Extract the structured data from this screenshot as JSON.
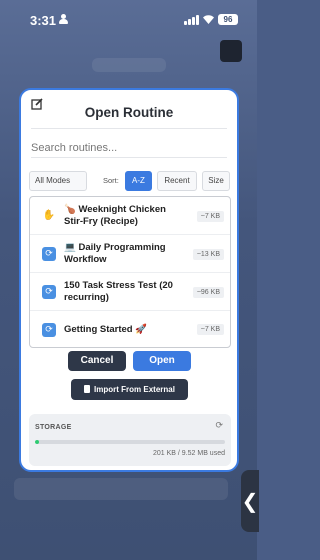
{
  "status_bar": {
    "time": "3:31",
    "battery": "96"
  },
  "dialog": {
    "title": "Open Routine",
    "search_placeholder": "Search routines...",
    "mode_filter": "All Modes",
    "sort_label": "Sort:",
    "sort_options": [
      {
        "label": "A-Z",
        "active": true
      },
      {
        "label": "Recent",
        "active": false
      },
      {
        "label": "Size",
        "active": false
      }
    ],
    "routines": [
      {
        "icon": "hand-icon",
        "glyph": "✋",
        "name": "🍗 Weeknight Chicken Stir-Fry (Recipe)",
        "size": "~7 KB"
      },
      {
        "icon": "sync-icon",
        "glyph": "⟳",
        "name": "💻 Daily Programming Workflow",
        "size": "~13 KB"
      },
      {
        "icon": "sync-icon",
        "glyph": "⟳",
        "name": "150 Task Stress Test (20 recurring)",
        "size": "~96 KB"
      },
      {
        "icon": "sync-icon",
        "glyph": "⟳",
        "name": "Getting Started 🚀",
        "size": "~7 KB"
      }
    ],
    "cancel_label": "Cancel",
    "open_label": "Open",
    "import_label": "Import From External",
    "storage": {
      "label": "STORAGE",
      "usage_text": "201 KB / 9.52 MB used",
      "used_fraction": 0.021
    }
  },
  "colors": {
    "accent": "#3b7ae0",
    "dark_button": "#2e3748",
    "storage_fill": "#2ecc71"
  }
}
